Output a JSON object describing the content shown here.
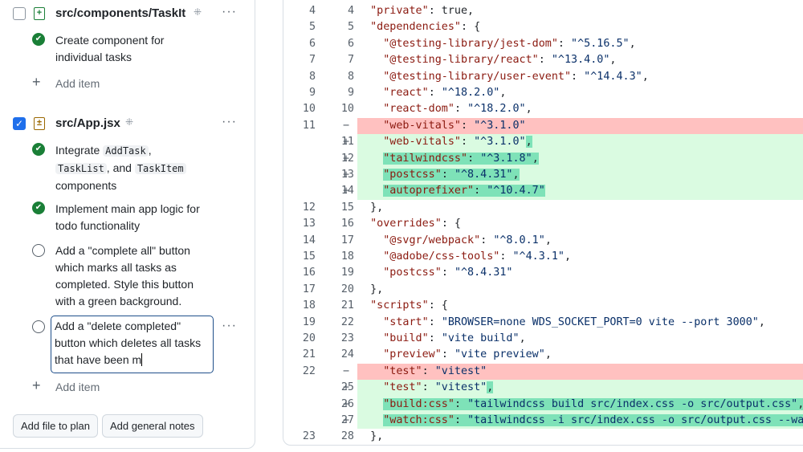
{
  "plan": {
    "files": [
      {
        "name": "src/components/TaskItem.jsx",
        "checked": false,
        "icon": "file-added-icon",
        "tasks": [
          {
            "done": true,
            "text": "Create component for individual tasks"
          }
        ]
      },
      {
        "name": "src/App.jsx",
        "checked": true,
        "icon": "file-diff-icon",
        "tasks": [
          {
            "done": true,
            "parts": [
              "Integrate ",
              "AddTask",
              ", ",
              "TaskList",
              ", and ",
              "TaskItem",
              " components"
            ]
          },
          {
            "done": true,
            "text": "Implement main app logic for todo functionality"
          },
          {
            "done": false,
            "text": "Add a \"complete all\" button which marks all tasks as completed. Style this button with a green background."
          },
          {
            "done": false,
            "editing": true,
            "text": "Add a \"delete completed\" button which deletes all tasks that have been m"
          }
        ]
      }
    ],
    "add_item_label": "Add item",
    "add_file_button": "Add file to plan",
    "add_notes_button": "Add general notes"
  },
  "diff": {
    "colors": {
      "deleted": "#ffc1c0",
      "added": "#dafbe1",
      "added_highlight": "#7ee2b8",
      "key": "#8b1a10",
      "string": "#0a3069"
    },
    "lines": [
      {
        "o": "4",
        "n": "4",
        "t": "ctx",
        "seg": [
          [
            "  ",
            ""
          ],
          [
            "\"private\"",
            "k"
          ],
          [
            ": true,",
            "p"
          ]
        ]
      },
      {
        "o": "5",
        "n": "5",
        "t": "ctx",
        "seg": [
          [
            "  ",
            ""
          ],
          [
            "\"dependencies\"",
            "k"
          ],
          [
            ": {",
            "p"
          ]
        ]
      },
      {
        "o": "6",
        "n": "6",
        "t": "ctx",
        "seg": [
          [
            "    ",
            ""
          ],
          [
            "\"@testing-library/jest-dom\"",
            "k"
          ],
          [
            ": ",
            "p"
          ],
          [
            "\"^5.16.5\"",
            "s"
          ],
          [
            ",",
            "p"
          ]
        ]
      },
      {
        "o": "7",
        "n": "7",
        "t": "ctx",
        "seg": [
          [
            "    ",
            ""
          ],
          [
            "\"@testing-library/react\"",
            "k"
          ],
          [
            ": ",
            "p"
          ],
          [
            "\"^13.4.0\"",
            "s"
          ],
          [
            ",",
            "p"
          ]
        ]
      },
      {
        "o": "8",
        "n": "8",
        "t": "ctx",
        "seg": [
          [
            "    ",
            ""
          ],
          [
            "\"@testing-library/user-event\"",
            "k"
          ],
          [
            ": ",
            "p"
          ],
          [
            "\"^14.4.3\"",
            "s"
          ],
          [
            ",",
            "p"
          ]
        ]
      },
      {
        "o": "9",
        "n": "9",
        "t": "ctx",
        "seg": [
          [
            "    ",
            ""
          ],
          [
            "\"react\"",
            "k"
          ],
          [
            ": ",
            "p"
          ],
          [
            "\"^18.2.0\"",
            "s"
          ],
          [
            ",",
            "p"
          ]
        ]
      },
      {
        "o": "10",
        "n": "10",
        "t": "ctx",
        "seg": [
          [
            "    ",
            ""
          ],
          [
            "\"react-dom\"",
            "k"
          ],
          [
            ": ",
            "p"
          ],
          [
            "\"^18.2.0\"",
            "s"
          ],
          [
            ",",
            "p"
          ]
        ]
      },
      {
        "o": "11",
        "n": "",
        "t": "del",
        "m": "−",
        "seg": [
          [
            "    ",
            ""
          ],
          [
            "\"web-vitals\"",
            "k"
          ],
          [
            ": ",
            "p"
          ],
          [
            "\"^3.1.0\"",
            "s"
          ]
        ]
      },
      {
        "o": "",
        "n": "11",
        "t": "ins",
        "m": "+",
        "seg": [
          [
            "    ",
            ""
          ],
          [
            "\"web-vitals\"",
            "k"
          ],
          [
            ": ",
            "p"
          ],
          [
            "\"^3.1.0\"",
            "s"
          ],
          [
            ",",
            "p hl"
          ]
        ]
      },
      {
        "o": "",
        "n": "12",
        "t": "ins",
        "m": "+",
        "seg": [
          [
            "    ",
            ""
          ],
          [
            "\"tailwindcss\"",
            "k hl"
          ],
          [
            ": ",
            "p hl"
          ],
          [
            "\"^3.1.8\"",
            "s hl"
          ],
          [
            ",",
            "p hl"
          ]
        ]
      },
      {
        "o": "",
        "n": "13",
        "t": "ins",
        "m": "+",
        "seg": [
          [
            "    ",
            ""
          ],
          [
            "\"postcss\"",
            "k hl"
          ],
          [
            ": ",
            "p hl"
          ],
          [
            "\"^8.4.31\"",
            "s hl"
          ],
          [
            ",",
            "p hl"
          ]
        ]
      },
      {
        "o": "",
        "n": "14",
        "t": "ins",
        "m": "+",
        "seg": [
          [
            "    ",
            ""
          ],
          [
            "\"autoprefixer\"",
            "k hl"
          ],
          [
            ": ",
            "p hl"
          ],
          [
            "\"^10.4.7\"",
            "s hl"
          ]
        ]
      },
      {
        "o": "12",
        "n": "15",
        "t": "ctx",
        "seg": [
          [
            "  },",
            "p"
          ]
        ]
      },
      {
        "o": "13",
        "n": "16",
        "t": "ctx",
        "seg": [
          [
            "  ",
            ""
          ],
          [
            "\"overrides\"",
            "k"
          ],
          [
            ": {",
            "p"
          ]
        ]
      },
      {
        "o": "14",
        "n": "17",
        "t": "ctx",
        "seg": [
          [
            "    ",
            ""
          ],
          [
            "\"@svgr/webpack\"",
            "k"
          ],
          [
            ": ",
            "p"
          ],
          [
            "\"^8.0.1\"",
            "s"
          ],
          [
            ",",
            "p"
          ]
        ]
      },
      {
        "o": "15",
        "n": "18",
        "t": "ctx",
        "seg": [
          [
            "    ",
            ""
          ],
          [
            "\"@adobe/css-tools\"",
            "k"
          ],
          [
            ": ",
            "p"
          ],
          [
            "\"^4.3.1\"",
            "s"
          ],
          [
            ",",
            "p"
          ]
        ]
      },
      {
        "o": "16",
        "n": "19",
        "t": "ctx",
        "seg": [
          [
            "    ",
            ""
          ],
          [
            "\"postcss\"",
            "k"
          ],
          [
            ": ",
            "p"
          ],
          [
            "\"^8.4.31\"",
            "s"
          ]
        ]
      },
      {
        "o": "17",
        "n": "20",
        "t": "ctx",
        "seg": [
          [
            "  },",
            "p"
          ]
        ]
      },
      {
        "o": "18",
        "n": "21",
        "t": "ctx",
        "seg": [
          [
            "  ",
            ""
          ],
          [
            "\"scripts\"",
            "k"
          ],
          [
            ": {",
            "p"
          ]
        ]
      },
      {
        "o": "19",
        "n": "22",
        "t": "ctx",
        "seg": [
          [
            "    ",
            ""
          ],
          [
            "\"start\"",
            "k"
          ],
          [
            ": ",
            "p"
          ],
          [
            "\"BROWSER=none WDS_SOCKET_PORT=0 vite --port 3000\"",
            "s"
          ],
          [
            ",",
            "p"
          ]
        ]
      },
      {
        "o": "20",
        "n": "23",
        "t": "ctx",
        "seg": [
          [
            "    ",
            ""
          ],
          [
            "\"build\"",
            "k"
          ],
          [
            ": ",
            "p"
          ],
          [
            "\"vite build\"",
            "s"
          ],
          [
            ",",
            "p"
          ]
        ]
      },
      {
        "o": "21",
        "n": "24",
        "t": "ctx",
        "seg": [
          [
            "    ",
            ""
          ],
          [
            "\"preview\"",
            "k"
          ],
          [
            ": ",
            "p"
          ],
          [
            "\"vite preview\"",
            "s"
          ],
          [
            ",",
            "p"
          ]
        ]
      },
      {
        "o": "22",
        "n": "",
        "t": "del",
        "m": "−",
        "seg": [
          [
            "    ",
            ""
          ],
          [
            "\"test\"",
            "k"
          ],
          [
            ": ",
            "p"
          ],
          [
            "\"vitest\"",
            "s"
          ]
        ]
      },
      {
        "o": "",
        "n": "25",
        "t": "ins",
        "m": "+",
        "seg": [
          [
            "    ",
            ""
          ],
          [
            "\"test\"",
            "k"
          ],
          [
            ": ",
            "p"
          ],
          [
            "\"vitest\"",
            "s"
          ],
          [
            ",",
            "p hl"
          ]
        ]
      },
      {
        "o": "",
        "n": "26",
        "t": "ins",
        "m": "+",
        "seg": [
          [
            "    ",
            ""
          ],
          [
            "\"build:css\"",
            "k hl"
          ],
          [
            ": ",
            "p hl"
          ],
          [
            "\"tailwindcss build src/index.css -o src/output.css\"",
            "s hl"
          ],
          [
            ",",
            "p hl"
          ]
        ]
      },
      {
        "o": "",
        "n": "27",
        "t": "ins",
        "m": "+",
        "seg": [
          [
            "    ",
            ""
          ],
          [
            "\"watch:css\"",
            "k hl"
          ],
          [
            ": ",
            "p hl"
          ],
          [
            "\"tailwindcss -i src/index.css -o src/output.css --watch\"",
            "s hl"
          ],
          [
            ",",
            "p hl"
          ]
        ]
      },
      {
        "o": "23",
        "n": "28",
        "t": "ctx",
        "seg": [
          [
            "  },",
            "p"
          ]
        ]
      }
    ]
  }
}
